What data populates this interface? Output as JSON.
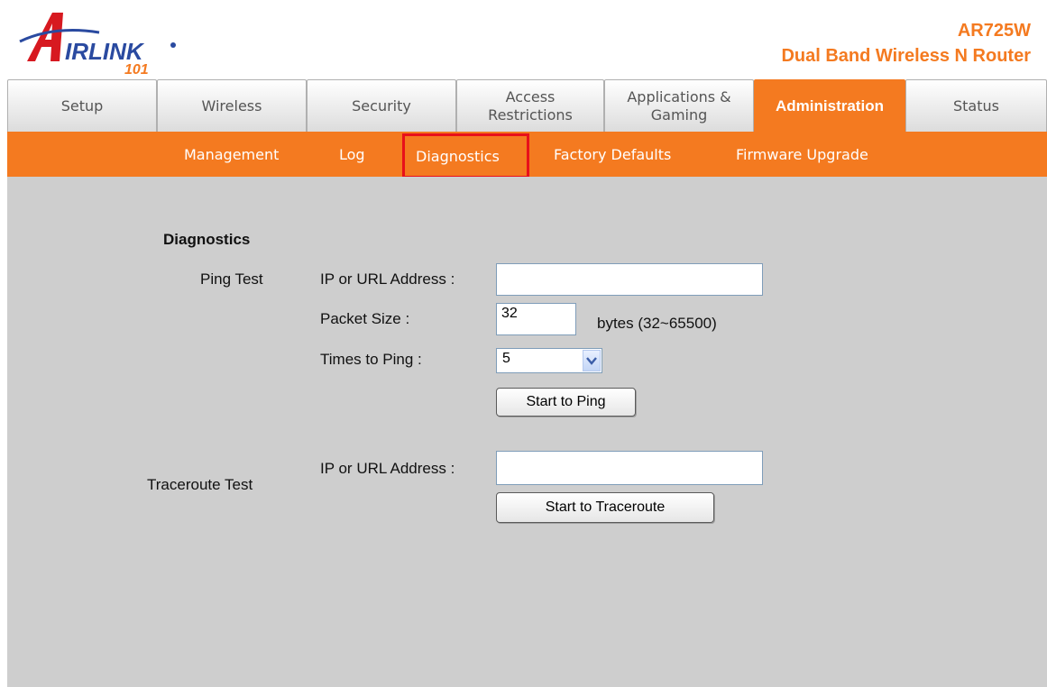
{
  "brand": {
    "logo_text": "IRLINK",
    "logo_number": "101",
    "model": "AR725W",
    "product": "Dual Band Wireless N Router",
    "accent_color": "#f47a20"
  },
  "tabs": [
    {
      "label": "Setup"
    },
    {
      "label": "Wireless"
    },
    {
      "label": "Security"
    },
    {
      "label": "Access Restrictions"
    },
    {
      "label": "Applications & Gaming"
    },
    {
      "label": "Administration"
    },
    {
      "label": "Status"
    }
  ],
  "subnav": [
    {
      "label": "Management"
    },
    {
      "label": "Log"
    },
    {
      "label": "Diagnostics"
    },
    {
      "label": "Factory Defaults"
    },
    {
      "label": "Firmware Upgrade"
    }
  ],
  "diagnostics": {
    "section_title": "Diagnostics",
    "ping_test_label": "Ping Test",
    "ping_address_label": "IP or URL Address :",
    "ping_address_value": "",
    "packet_size_label": "Packet Size :",
    "packet_size_value": "32",
    "packet_size_hint": "bytes (32~65500)",
    "times_label": "Times to Ping :",
    "times_value": "5",
    "start_ping_button": "Start to Ping",
    "traceroute_test_label": "Traceroute Test",
    "traceroute_address_label": "IP or URL Address :",
    "traceroute_address_value": "",
    "start_traceroute_button": "Start to Traceroute"
  }
}
